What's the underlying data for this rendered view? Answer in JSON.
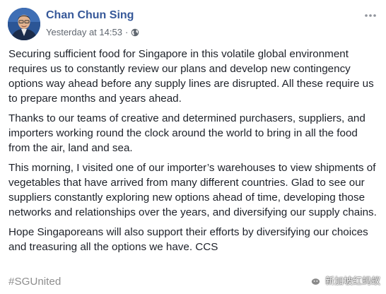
{
  "post": {
    "author": "Chan Chun Sing",
    "timestamp": "Yesterday at 14:53",
    "separator": "·",
    "privacy_icon": "globe-icon",
    "more_icon": "more-options-icon",
    "paragraphs": [
      "Securing sufficient food for Singapore in this volatile global environment requires us to constantly review our plans and develop new contingency options way ahead before any supply lines are disrupted. All these require us to prepare months and years ahead.",
      "Thanks to our teams of creative and determined purchasers, suppliers, and importers working round the clock around the world to bring in all the food from the air, land and sea.",
      "This morning, I visited one of our importer’s warehouses to view shipments of vegetables that have arrived from many different countries. Glad to see our suppliers constantly exploring new options ahead of time, developing those networks and relationships over the years, and diversifying our supply chains.",
      "Hope Singaporeans will also support their efforts by diversifying our choices and treasuring all the options we have. CCS"
    ],
    "hashtag": "#SGUnited"
  },
  "watermark": {
    "text": "新加坡红蚂蚁",
    "icon": "wechat-icon"
  },
  "colors": {
    "author_link": "#365899",
    "body_text": "#1d2129",
    "meta_text": "#606770",
    "hashtag": "#8e8e8e"
  }
}
